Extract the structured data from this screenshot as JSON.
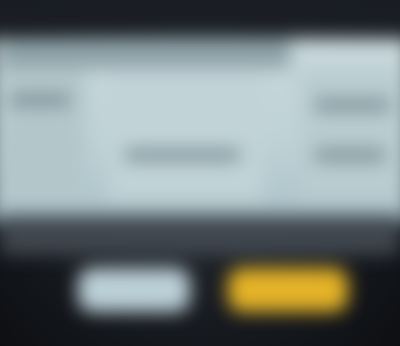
{
  "dialog": {
    "title": "",
    "message": "",
    "secondary_button_label": "",
    "primary_button_label": ""
  },
  "colors": {
    "panel": "#c1d3d7",
    "secondary_button": "#bcd0d8",
    "primary_button": "#e4b328",
    "background": "#14171c"
  }
}
